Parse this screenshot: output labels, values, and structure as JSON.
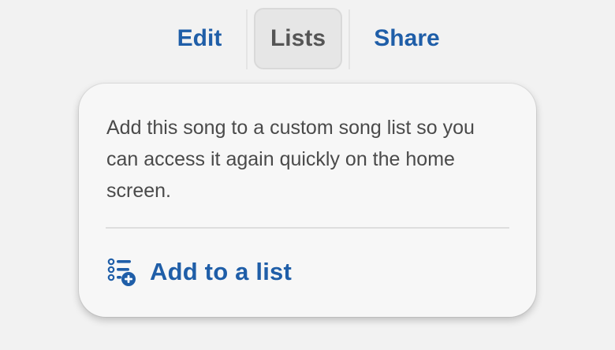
{
  "tabs": {
    "edit_label": "Edit",
    "lists_label": "Lists",
    "share_label": "Share",
    "active": "Lists"
  },
  "popover": {
    "description": "Add this song to a custom song list so you can access it again quickly on the home screen.",
    "action_label": "Add to a list",
    "action_icon": "list-add-icon"
  },
  "colors": {
    "accent": "#1f5ea8",
    "muted_tab_text": "#555555",
    "active_tab_bg": "#e6e6e6",
    "background": "#f2f2f2",
    "popover_bg": "#f7f7f7"
  }
}
